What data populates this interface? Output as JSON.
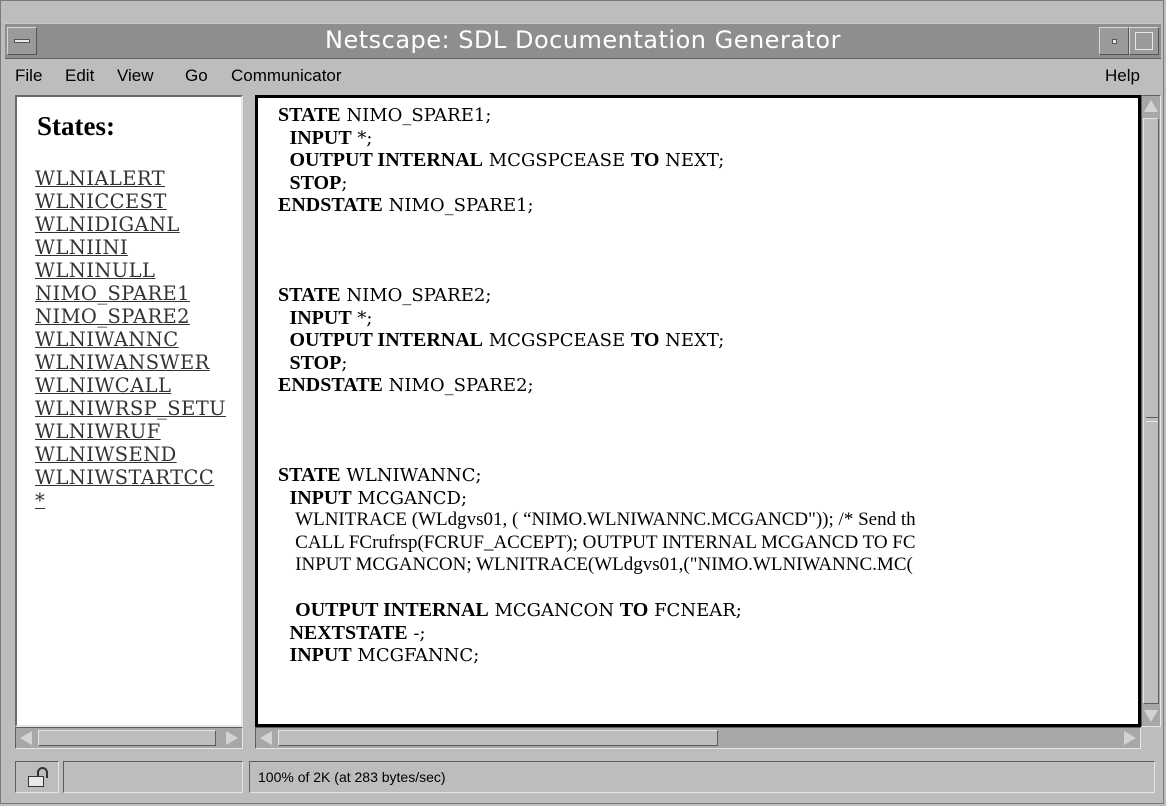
{
  "window": {
    "title": "Netscape: SDL Documentation Generator"
  },
  "menubar": {
    "file": "File",
    "edit": "Edit",
    "view": "View",
    "go": "Go",
    "communicator": "Communicator",
    "help": "Help"
  },
  "sidebar": {
    "heading": "States:",
    "links": [
      "WLNIALERT",
      "WLNICCEST",
      "WLNIDIGANL",
      "WLNIINI",
      "WLNINULL",
      "NIMO_SPARE1",
      "NIMO_SPARE2",
      "WLNIWANNC",
      "WLNIWANSWER",
      "WLNIWCALL",
      "WLNIWRSP_SETU",
      "WLNIWRUF",
      "WLNIWSEND",
      "WLNIWSTARTCC",
      "*"
    ]
  },
  "content": {
    "lines": [
      {
        "kw": "STATE",
        "text": " NIMO_SPARE1;",
        "indent": ""
      },
      {
        "kw": "INPUT",
        "text": " *;",
        "indent": "  "
      },
      {
        "kw": "OUTPUT INTERNAL",
        "text": " MCGSPCEASE ",
        "kw2": "TO",
        "text2": " NEXT;",
        "indent": "  "
      },
      {
        "kw": "STOP",
        "text": ";",
        "indent": "  "
      },
      {
        "kw": "ENDSTATE",
        "text": " NIMO_SPARE1;",
        "indent": ""
      },
      {
        "kw": "",
        "text": "",
        "indent": ""
      },
      {
        "kw": "",
        "text": "",
        "indent": ""
      },
      {
        "kw": "",
        "text": "",
        "indent": ""
      },
      {
        "kw": "STATE",
        "text": " NIMO_SPARE2;",
        "indent": ""
      },
      {
        "kw": "INPUT",
        "text": " *;",
        "indent": "  "
      },
      {
        "kw": "OUTPUT INTERNAL",
        "text": " MCGSPCEASE ",
        "kw2": "TO",
        "text2": " NEXT;",
        "indent": "  "
      },
      {
        "kw": "STOP",
        "text": ";",
        "indent": "  "
      },
      {
        "kw": "ENDSTATE",
        "text": " NIMO_SPARE2;",
        "indent": ""
      },
      {
        "kw": "",
        "text": "",
        "indent": ""
      },
      {
        "kw": "",
        "text": "",
        "indent": ""
      },
      {
        "kw": "",
        "text": "",
        "indent": ""
      },
      {
        "kw": "STATE",
        "text": " WLNIWANNC;",
        "indent": ""
      },
      {
        "kw": "INPUT",
        "text": " MCGANCD;",
        "indent": "  "
      },
      {
        "kw": "",
        "text": "WLNITRACE (WLdgvs01, ( “NIMO.WLNIWANNC.MCGANCD\")); /* Send th",
        "indent": "   "
      },
      {
        "kw": "",
        "text": "CALL FCrufrsp(FCRUF_ACCEPT); OUTPUT INTERNAL MCGANCD TO FC",
        "indent": "   "
      },
      {
        "kw": "",
        "text": "INPUT MCGANCON; WLNITRACE(WLdgvs01,(\"NIMO.WLNIWANNC.MC(",
        "indent": "   "
      },
      {
        "kw": "",
        "text": "",
        "indent": ""
      },
      {
        "kw": "OUTPUT INTERNAL",
        "text": " MCGANCON ",
        "kw2": "TO",
        "text2": " FCNEAR;",
        "indent": "   "
      },
      {
        "kw": "NEXTSTATE",
        "text": " -;",
        "indent": "  "
      },
      {
        "kw": "INPUT",
        "text": " MCGFANNC;",
        "indent": "  "
      }
    ]
  },
  "status": {
    "text": "100% of 2K (at 283 bytes/sec)"
  },
  "icons": {
    "lock": "lock-icon",
    "window_menu": "window-menu-icon",
    "minimize": "minimize-icon",
    "maximize": "maximize-icon"
  }
}
